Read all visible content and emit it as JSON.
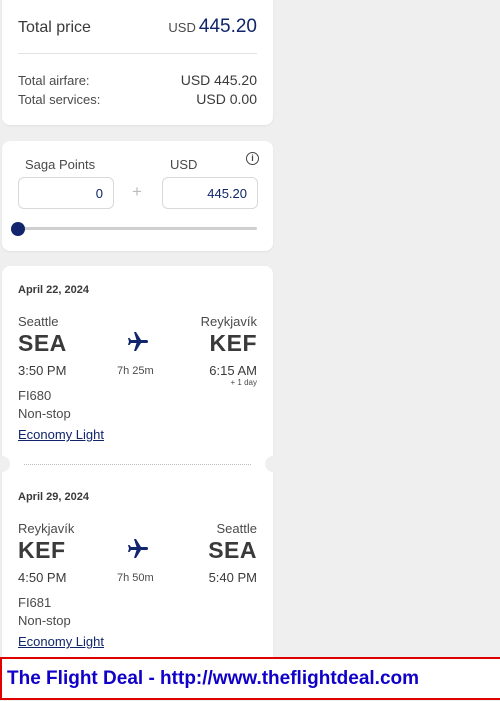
{
  "price": {
    "total_label": "Total price",
    "total_currency": "USD",
    "total_amount": "445.20",
    "airfare_label": "Total airfare:",
    "airfare_value": "USD 445.20",
    "services_label": "Total services:",
    "services_value": "USD 0.00"
  },
  "points": {
    "points_label": "Saga Points",
    "currency_label": "USD",
    "points_value": "0",
    "usd_value": "445.20",
    "plus_symbol": "+",
    "slider_fraction": 0
  },
  "flights": [
    {
      "date": "April 22, 2024",
      "origin_city": "Seattle",
      "origin_code": "SEA",
      "dest_city": "Reykjavík",
      "dest_code": "KEF",
      "depart_time": "3:50 PM",
      "duration": "7h 25m",
      "arrive_time": "6:15 AM",
      "day_offset": "+ 1 day",
      "flight_no": "FI680",
      "stops": "Non-stop",
      "fare": "Economy Light"
    },
    {
      "date": "April 29, 2024",
      "origin_city": "Reykjavík",
      "origin_code": "KEF",
      "dest_city": "Seattle",
      "dest_code": "SEA",
      "depart_time": "4:50 PM",
      "duration": "7h 50m",
      "arrive_time": "5:40 PM",
      "flight_no": "FI681",
      "stops": "Non-stop",
      "fare": "Economy Light"
    }
  ],
  "banner": {
    "text": "The Flight Deal - http://www.theflightdeal.com"
  },
  "colors": {
    "accent": "#10256b",
    "banner_text": "#1000c8",
    "banner_border": "#e00000"
  }
}
